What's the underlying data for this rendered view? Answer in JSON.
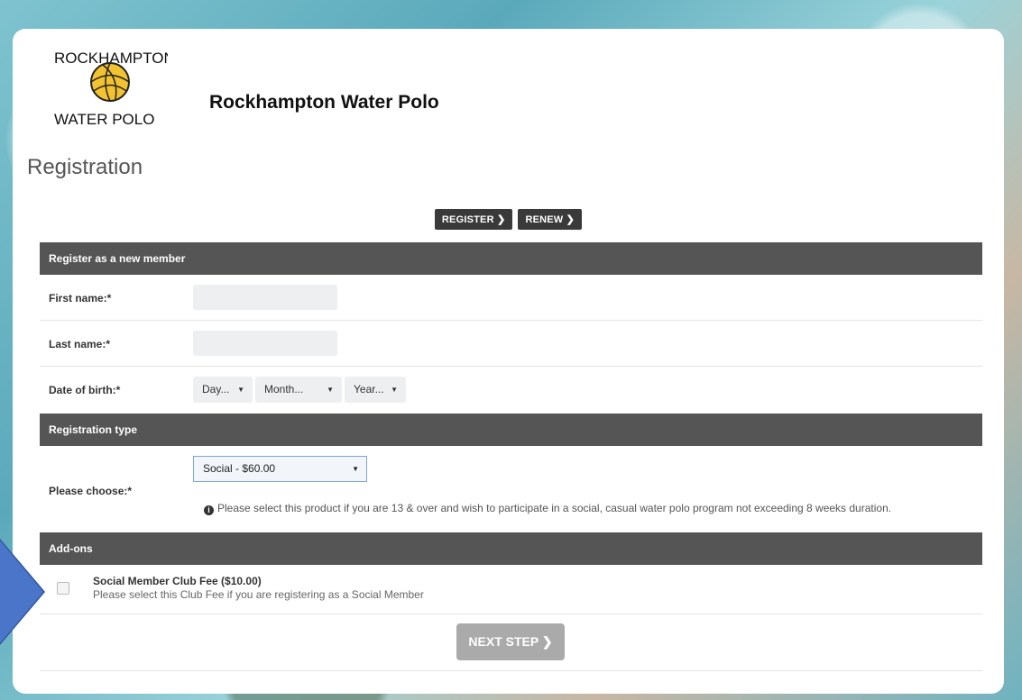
{
  "org": {
    "logo_top": "ROCKHAMPTON",
    "logo_bottom": "WATER POLO",
    "name": "Rockhampton Water Polo"
  },
  "page": {
    "title": "Registration"
  },
  "nav": {
    "register_label": "REGISTER",
    "renew_label": "RENEW"
  },
  "member_section": {
    "heading": "Register as a new member",
    "first_name_label": "First name:*",
    "first_name_value": "",
    "last_name_label": "Last name:*",
    "last_name_value": "",
    "dob_label": "Date of birth:*",
    "dob_day": "Day...",
    "dob_month": "Month...",
    "dob_year": "Year..."
  },
  "registration_type": {
    "heading": "Registration type",
    "choose_label": "Please choose:*",
    "selected": "Social - $60.00",
    "info": "Please select this product if you are 13 & over and wish to participate in a social, casual water polo program not exceeding 8 weeks duration."
  },
  "addons": {
    "heading": "Add-ons",
    "items": [
      {
        "title": "Social Member Club Fee ($10.00)",
        "description": "Please select this Club Fee if you are registering as a Social Member",
        "checked": false
      }
    ]
  },
  "actions": {
    "next_label": "NEXT STEP"
  },
  "colors": {
    "section_header": "#555555",
    "dark_button": "#3a3a3a",
    "next_button_disabled": "#aaaaaa",
    "annotation_arrow": "#4a75c9"
  }
}
